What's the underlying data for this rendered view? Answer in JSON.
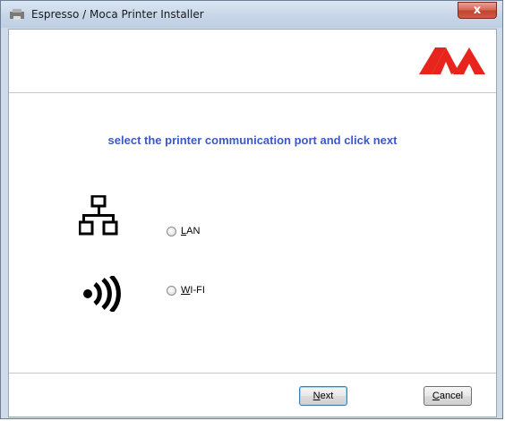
{
  "window": {
    "title": "Espresso / Moca Printer Installer",
    "close_label": "x"
  },
  "header": {
    "logo_icon": "moca-logo-icon",
    "logo_color": "#e8251c"
  },
  "main": {
    "instruction": "select the printer communication port and click next",
    "instruction_color": "#3a59c9",
    "options": [
      {
        "icon": "network-lan-icon",
        "mnemonic": "L",
        "rest": "AN",
        "selected": false
      },
      {
        "icon": "wifi-signal-icon",
        "mnemonic": "W",
        "rest": "I-FI",
        "selected": false
      }
    ]
  },
  "footer": {
    "next": {
      "mnemonic": "N",
      "rest": "ext"
    },
    "cancel": {
      "mnemonic": "C",
      "rest": "ancel"
    }
  }
}
